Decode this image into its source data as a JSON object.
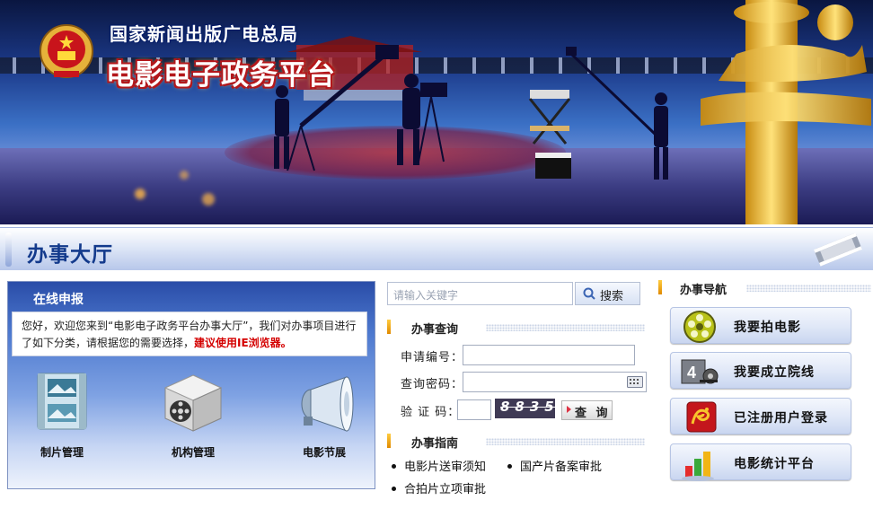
{
  "header": {
    "org_name": "国家新闻出版广电总局",
    "site_title": "电影电子政务平台"
  },
  "hall": {
    "title": "办事大厅"
  },
  "online_filing": {
    "title": "在线申报",
    "welcome_text": "您好，欢迎您来到“电影电子政务平台办事大厅”，我们对办事项目进行了如下分类，请根据您的需要选择，",
    "browser_tip": "建议使用IE浏览器。",
    "services": [
      {
        "label": "制片管理",
        "icon": "film-frames-icon"
      },
      {
        "label": "机构管理",
        "icon": "film-cube-icon"
      },
      {
        "label": "电影节展",
        "icon": "megaphone-icon"
      }
    ]
  },
  "search": {
    "placeholder": "请输入关键字",
    "button_label": "搜索"
  },
  "query": {
    "title": "办事查询",
    "app_number_label": "申请编号：",
    "password_label": "查询密码：",
    "captcha_label": "验 证 码：",
    "captcha_text": "8835",
    "submit_label": "查 询"
  },
  "guide": {
    "title": "办事指南",
    "items": [
      "电影片送审须知",
      "国产片备案审批",
      "合拍片立项审批"
    ]
  },
  "nav": {
    "title": "办事导航",
    "buttons": [
      {
        "label": "我要拍电影",
        "icon": "film-reel-icon"
      },
      {
        "label": "我要成立院线",
        "icon": "film-projector-icon"
      },
      {
        "label": "已注册用户登录",
        "icon": "dragon-icon"
      },
      {
        "label": "电影统计平台",
        "icon": "bar-chart-icon"
      }
    ]
  },
  "colors": {
    "accent_blue": "#133a8c",
    "warning_red": "#d40000",
    "section_bar_gold": "#e08a00"
  }
}
